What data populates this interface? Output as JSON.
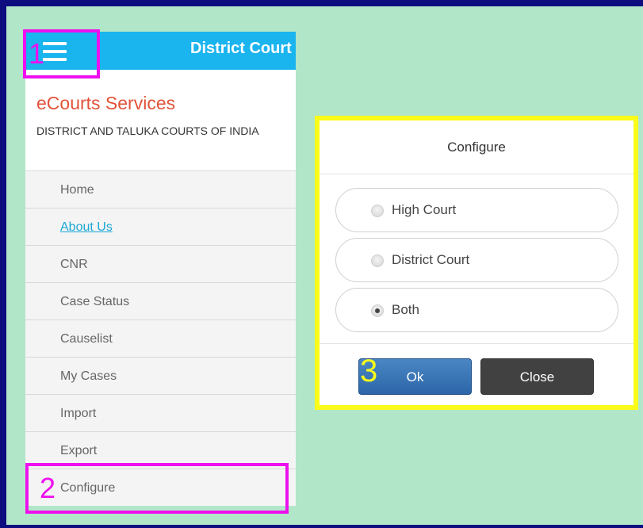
{
  "app": {
    "header_title": "District Court",
    "brand": "eCourts Services",
    "subtitle": "DISTRICT AND TALUKA COURTS OF INDIA"
  },
  "nav": {
    "items": [
      {
        "label": "Home"
      },
      {
        "label": "About Us"
      },
      {
        "label": "CNR"
      },
      {
        "label": "Case Status"
      },
      {
        "label": "Causelist"
      },
      {
        "label": "My Cases"
      },
      {
        "label": "Import"
      },
      {
        "label": "Export"
      },
      {
        "label": "Configure"
      }
    ]
  },
  "annotations": {
    "step1": "1",
    "step2": "2",
    "step3": "3",
    "highlight_color": "#ee10ee",
    "dialog_highlight_color": "#fbfb1a"
  },
  "dialog": {
    "title": "Configure",
    "options": [
      {
        "label": "High Court",
        "selected": false
      },
      {
        "label": "District Court",
        "selected": false
      },
      {
        "label": "Both",
        "selected": true
      }
    ],
    "ok_label": "Ok",
    "close_label": "Close"
  },
  "colors": {
    "header": "#1ab4ef",
    "brand": "#e2533a",
    "link": "#1aa7d6",
    "background": "#b2e6c8",
    "frame": "#0d0d80"
  }
}
